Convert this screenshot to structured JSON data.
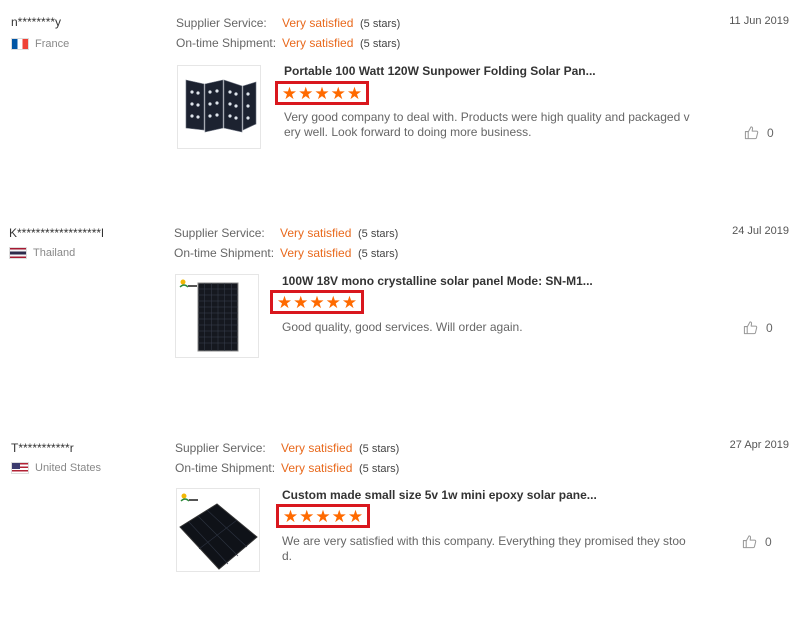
{
  "reviews": [
    {
      "user": "n********y",
      "country": "France",
      "flag": "fr",
      "supplier_label": "Supplier Service:",
      "supplier_value": "Very satisfied",
      "supplier_stars": "(5 stars)",
      "shipment_label": "On-time Shipment:",
      "shipment_value": "Very satisfied",
      "shipment_stars": "(5 stars)",
      "date": "11 Jun 2019",
      "product_title": "Portable 100 Watt 120W Sunpower Folding Solar Pan...",
      "rating": 5,
      "comment": "Very good company to deal with. Products were high quality and packaged very well. Look forward to doing more business.",
      "likes": "0"
    },
    {
      "user": "K******************l",
      "country": "Thailand",
      "flag": "th",
      "supplier_label": "Supplier Service:",
      "supplier_value": "Very satisfied",
      "supplier_stars": "(5 stars)",
      "shipment_label": "On-time Shipment:",
      "shipment_value": "Very satisfied",
      "shipment_stars": "(5 stars)",
      "date": "24 Jul 2019",
      "product_title": "100W 18V mono crystalline solar panel Mode: SN-M1...",
      "rating": 5,
      "comment": "Good quality, good services. Will order again.",
      "likes": "0"
    },
    {
      "user": "T***********r",
      "country": "United States",
      "flag": "us",
      "supplier_label": "Supplier Service:",
      "supplier_value": "Very satisfied",
      "supplier_stars": "(5 stars)",
      "shipment_label": "On-time Shipment:",
      "shipment_value": "Very satisfied",
      "shipment_stars": "(5 stars)",
      "date": "27 Apr 2019",
      "product_title": "Custom made small size 5v 1w mini epoxy solar pane...",
      "rating": 5,
      "comment": "We are very satisfied with this company. Everything they promised they stood.",
      "likes": "0"
    }
  ],
  "colors": {
    "accent": "#e8691d",
    "star": "#ff6a00",
    "highlight_box": "#d9171e"
  }
}
